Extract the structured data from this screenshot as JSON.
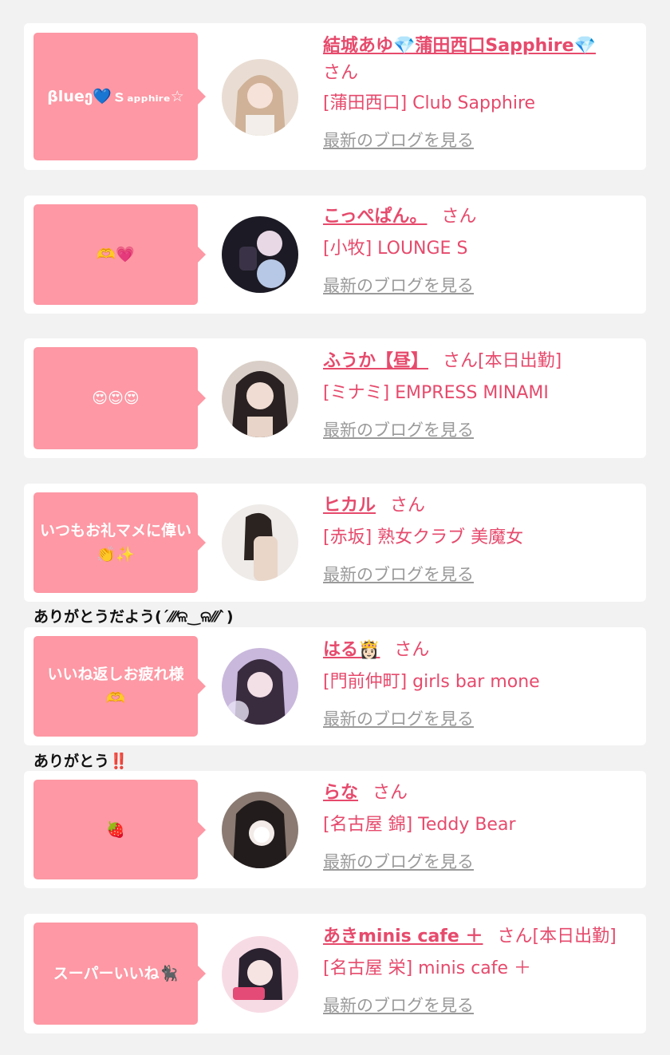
{
  "entries": [
    {
      "bubble": "βlueე💙ｓₐₚₚₕᵢᵣₑ☆",
      "name": "結城あゆ💎蒲田西口Sapphire💎",
      "san": "さん",
      "status": "",
      "shop": "[蒲田西口] Club Sapphire",
      "blog": "最新のブログを見る"
    },
    {
      "bubble": "🫶💗",
      "name": "こっぺぱん。",
      "san": "さん",
      "status": "",
      "shop": "[小牧] LOUNGE S",
      "blog": "最新のブログを見る"
    },
    {
      "bubble": "😍😍😍",
      "name": "ふうか【昼】",
      "san": "さん",
      "status": "[本日出勤]",
      "shop": "[ミナミ] EMPRESS MINAMI",
      "blog": "最新のブログを見る"
    },
    {
      "bubble": "いつもお礼マメに偉い👏✨",
      "name": "ヒカル",
      "san": "さん",
      "status": "",
      "shop": "[赤坂] 熟女クラブ 美魔女",
      "blog": "最新のブログを見る"
    },
    {
      "bubble": "いいね返しお疲れ様🫶",
      "name": "はる👸🏻",
      "san": "さん",
      "status": "",
      "shop": "[門前仲町] girls bar mone",
      "blog": "最新のブログを見る"
    },
    {
      "bubble": "🍓",
      "name": "らな",
      "san": "さん",
      "status": "",
      "shop": "[名古屋 錦] Teddy Bear",
      "blog": "最新のブログを見る"
    },
    {
      "bubble": "スーパーいいね🐈‍⬛",
      "name": "あきminis cafe ＋",
      "san": "さん",
      "status": "[本日出勤]",
      "shop": "[名古屋 栄] minis cafe ＋",
      "blog": "最新のブログを見る"
    }
  ],
  "captions": {
    "after_4": "ありがとうだよう(ˊ⁄⁄⁄ଳ‿ଳ⁄⁄⁄ˋ)",
    "after_5": "ありがとう‼️"
  },
  "colors": {
    "page_bg": "#f2f2f2",
    "card_bg": "#ffffff",
    "bubble_pink": "#fd98a4",
    "name_pink": "#e64a6c",
    "link_gray": "#9a9a9a"
  }
}
